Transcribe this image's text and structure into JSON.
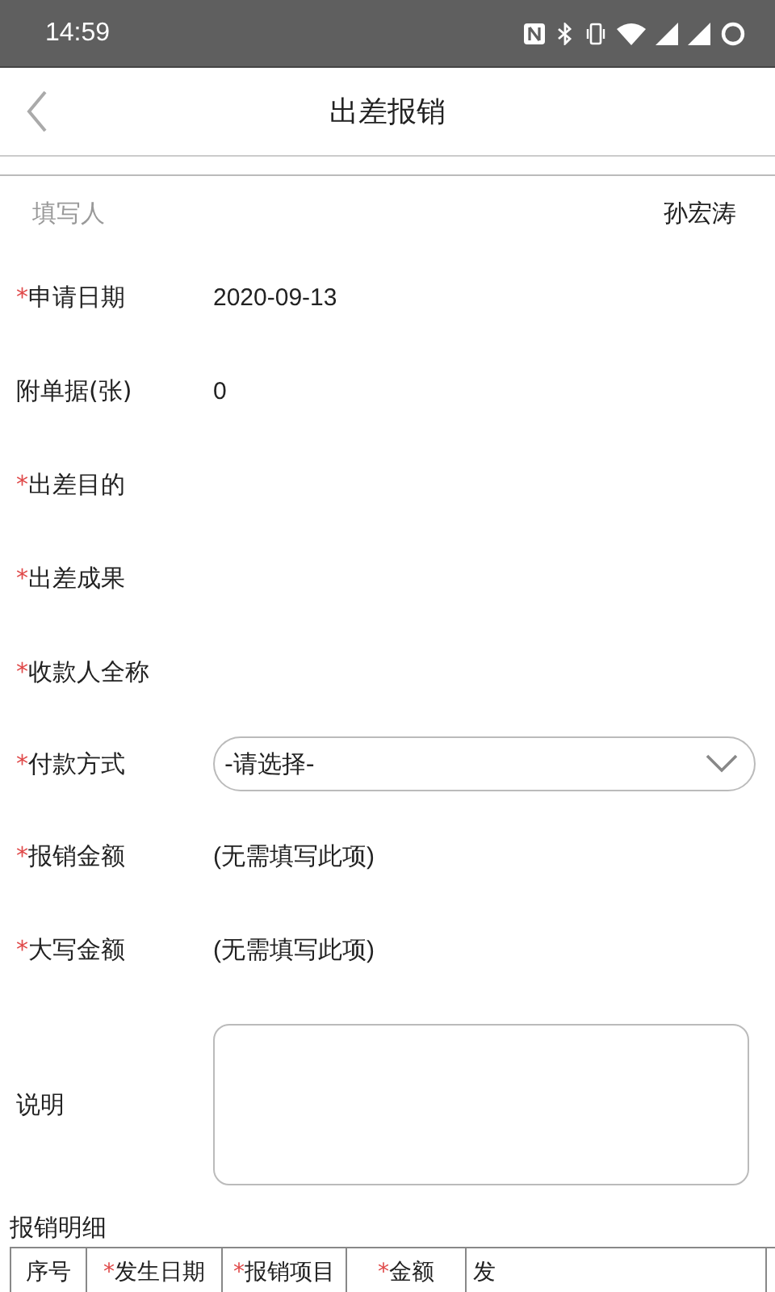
{
  "status_bar": {
    "time": "14:59"
  },
  "header": {
    "title": "出差报销"
  },
  "filler": {
    "label": "填写人",
    "value": "孙宏涛"
  },
  "fields": [
    {
      "kind": "text",
      "asterisk": "*",
      "label": "申请日期",
      "value": "2020-09-13"
    },
    {
      "kind": "text",
      "label": "附单据(张)",
      "value": "0"
    },
    {
      "kind": "text",
      "asterisk": "*",
      "label": "出差目的"
    },
    {
      "kind": "text",
      "asterisk": "*",
      "label": "出差成果"
    },
    {
      "kind": "text",
      "asterisk": "*",
      "label": "收款人全称"
    },
    {
      "kind": "select",
      "asterisk": "*",
      "label": "付款方式",
      "value": "-请选择-"
    },
    {
      "kind": "text",
      "asterisk": "*",
      "label": "报销金额",
      "value": "(无需填写此项)"
    },
    {
      "kind": "text",
      "asterisk": "*",
      "label": "大写金额",
      "value": "(无需填写此项)"
    },
    {
      "kind": "textarea",
      "label": "说明"
    }
  ],
  "details": {
    "title": "报销明细",
    "columns": [
      {
        "label": "序号"
      },
      {
        "asterisk": "*",
        "label": "发生日期"
      },
      {
        "asterisk": "*",
        "label": "报销项目"
      },
      {
        "asterisk": "*",
        "label": "金额"
      },
      {
        "label": "发"
      }
    ]
  }
}
